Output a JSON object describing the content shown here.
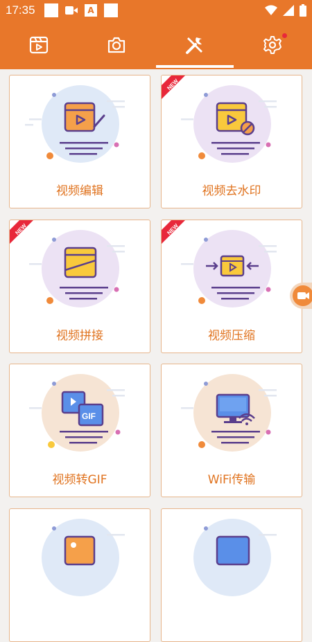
{
  "status_bar": {
    "time": "17:35"
  },
  "tabs": [
    {
      "name": "videos",
      "icon": "film-icon"
    },
    {
      "name": "camera",
      "icon": "camera-icon"
    },
    {
      "name": "tools",
      "icon": "tools-icon",
      "active": true
    },
    {
      "name": "settings",
      "icon": "gear-icon",
      "has_notification_dot": true
    }
  ],
  "tools": [
    {
      "label": "视频编辑",
      "badge": ""
    },
    {
      "label": "视频去水印",
      "badge": "NEW"
    },
    {
      "label": "视频拼接",
      "badge": "NEW"
    },
    {
      "label": "视频压缩",
      "badge": "NEW"
    },
    {
      "label": "视频转GIF",
      "badge": "",
      "gif_text": "GIF"
    },
    {
      "label": "WiFi传输",
      "badge": ""
    },
    {
      "label": "",
      "badge": ""
    },
    {
      "label": "",
      "badge": ""
    }
  ],
  "colors": {
    "accent": "#e8772a",
    "label": "#e0731f",
    "card_border": "#e6b48a",
    "new_badge": "#e8283a"
  }
}
